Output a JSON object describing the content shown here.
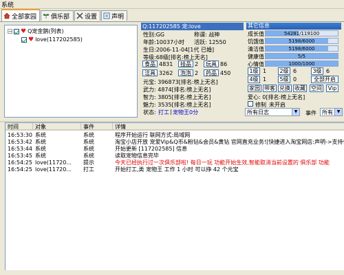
{
  "window": {
    "title": "系统"
  },
  "tabs": [
    {
      "label": "全部家园",
      "active": true
    },
    {
      "label": "俱乐部"
    },
    {
      "label": "设置"
    },
    {
      "label": "声明"
    }
  ],
  "tree": {
    "root": "Q宠金鹅(列表)",
    "child": "love(117202585)"
  },
  "pet": {
    "header": "Q:117202585 宠:love",
    "gender": "性别:GG",
    "title": "称谓: 战神",
    "age": "年龄:10037小时",
    "vitality": "活跃: 12550",
    "birth": "生日:2006-11-04[1代 已婚]",
    "level": "等级:68级[排名:榜上无名]",
    "food_label": "食品",
    "food_val": "4831",
    "dock_label": "挂品",
    "dock_val": "2",
    "toy_label": "玩具",
    "toy_val": "86",
    "clean_label": "洁具",
    "clean_val": "3262",
    "gift_label": "泡泡",
    "gift_val": "2",
    "med_label": "药品",
    "med_val": "450",
    "yuanbao": "元宝: 396873[排名:榜上无名]",
    "wuli": "武力: 4874[排名:榜上无名]",
    "zhili": "智力: 3805[排名:榜上无名]",
    "meili": "魅力: 3535[排名:榜上无名]",
    "status_label": "状态:",
    "status_work": "打工",
    "status_club": "宠物王0分"
  },
  "other": {
    "header": "其它信息",
    "stats": [
      {
        "label": "成长值",
        "text": "54281/119100",
        "fraction": 0.456
      },
      {
        "label": "饥饿值",
        "text": "5198/6000",
        "fraction": 0.866
      },
      {
        "label": "清洁值",
        "text": "5198/6000",
        "fraction": 0.866
      },
      {
        "label": "健康值",
        "text": "5/5",
        "fraction": 1.0
      },
      {
        "label": "心情值",
        "text": "1000/1000",
        "fraction": 1.0
      }
    ],
    "levels": [
      "1级",
      "2级",
      "3级",
      "4级",
      "5级"
    ],
    "level_counts": [
      "1",
      "6",
      "6",
      "1",
      "0"
    ],
    "all_label": "全部开启",
    "buttons": [
      "家园",
      "带客",
      "兑换",
      "收藏",
      "空间",
      "Vip"
    ],
    "love": "爱心: 0[排名:榜上无名]",
    "cultivate": "修制",
    "cultivate_val": "未开启",
    "log_select": "所有日志",
    "event_label": "事件",
    "event_select": "所有"
  },
  "log": {
    "columns": [
      "时间",
      "对象",
      "事件",
      "详情"
    ],
    "rows": [
      {
        "time": "16:53:30",
        "obj": "系统",
        "event": "系统",
        "detail": "程序开始运行 联网方式:局域网",
        "red": false
      },
      {
        "time": "16:53:42",
        "obj": "系统",
        "event": "系统",
        "detail": "淘宝小店开放 宠爱Vip&Q币&粉钻&会员&黄钻 官网直充业务![快捷进入淘宝网店:声明->支持作",
        "red": false
      },
      {
        "time": "16:53:44",
        "obj": "系统",
        "event": "系统",
        "detail": "开始更新 [117202585] 信息",
        "red": false
      },
      {
        "time": "16:53:45",
        "obj": "系统",
        "event": "系统",
        "detail": "读取宠物信息完毕",
        "red": false
      },
      {
        "time": "16:54:25",
        "obj": "love(11720...",
        "event": "提示",
        "detail": "今天已经执行过一次俱乐部啦! 每日一玩 功能开始生效,智能取消当前设置的 俱乐部 功能",
        "red": true
      },
      {
        "time": "16:54:25",
        "obj": "love(11720...",
        "event": "打工",
        "detail": "开始打工,类 宠物王 工作 1 小时 可以挣 42 个元宝",
        "red": false
      }
    ]
  }
}
